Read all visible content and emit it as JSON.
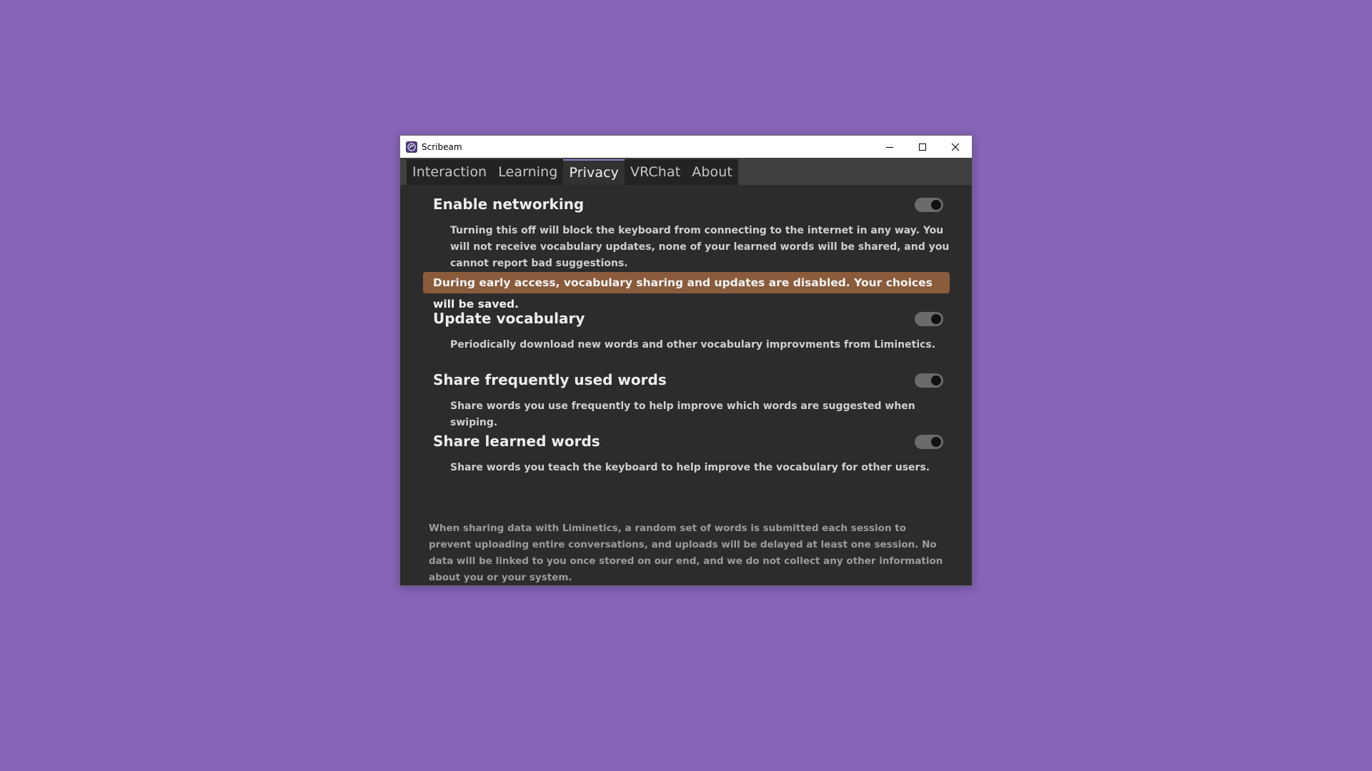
{
  "window": {
    "title": "Scribeam",
    "controls": {
      "minimize_icon": "minimize-icon",
      "maximize_icon": "maximize-icon",
      "close_icon": "close-icon"
    }
  },
  "tabs": [
    {
      "label": "Interaction",
      "active": false
    },
    {
      "label": "Learning",
      "active": false
    },
    {
      "label": "Privacy",
      "active": true
    },
    {
      "label": "VRChat",
      "active": false
    },
    {
      "label": "About",
      "active": false
    }
  ],
  "privacy": {
    "networking": {
      "title": "Enable networking",
      "description": "Turning this off will block the keyboard from connecting to the internet in any way. You will not receive vocabulary updates, none of your learned words will be shared, and you cannot report bad suggestions.",
      "enabled": true
    },
    "banner": "During early access, vocabulary sharing and updates are disabled. Your choices will be saved.",
    "update_vocabulary": {
      "title": "Update vocabulary",
      "description": "Periodically download new words and other vocabulary improvments from Liminetics.",
      "enabled": true
    },
    "share_frequent": {
      "title": "Share frequently used words",
      "description": "Share words you use frequently to help improve which words are suggested when swiping.",
      "enabled": true
    },
    "share_learned": {
      "title": "Share learned words",
      "description": "Share words you teach the keyboard to help improve the vocabulary for other users.",
      "enabled": true
    },
    "footer": "When sharing data with Liminetics, a random set of words is submitted each session to prevent uploading entire conversations, and uploads will be delayed at least one session. No data will be linked to you once stored on our end, and we do not collect any other information about you or your system."
  },
  "colors": {
    "desktop": "#8664b8",
    "window_bg": "#2c2c2c",
    "tab_active_accent": "#8c79c6",
    "banner_bg": "#8a5c3c",
    "toggle_track": "#6b6b6b",
    "toggle_knob": "#111111"
  }
}
